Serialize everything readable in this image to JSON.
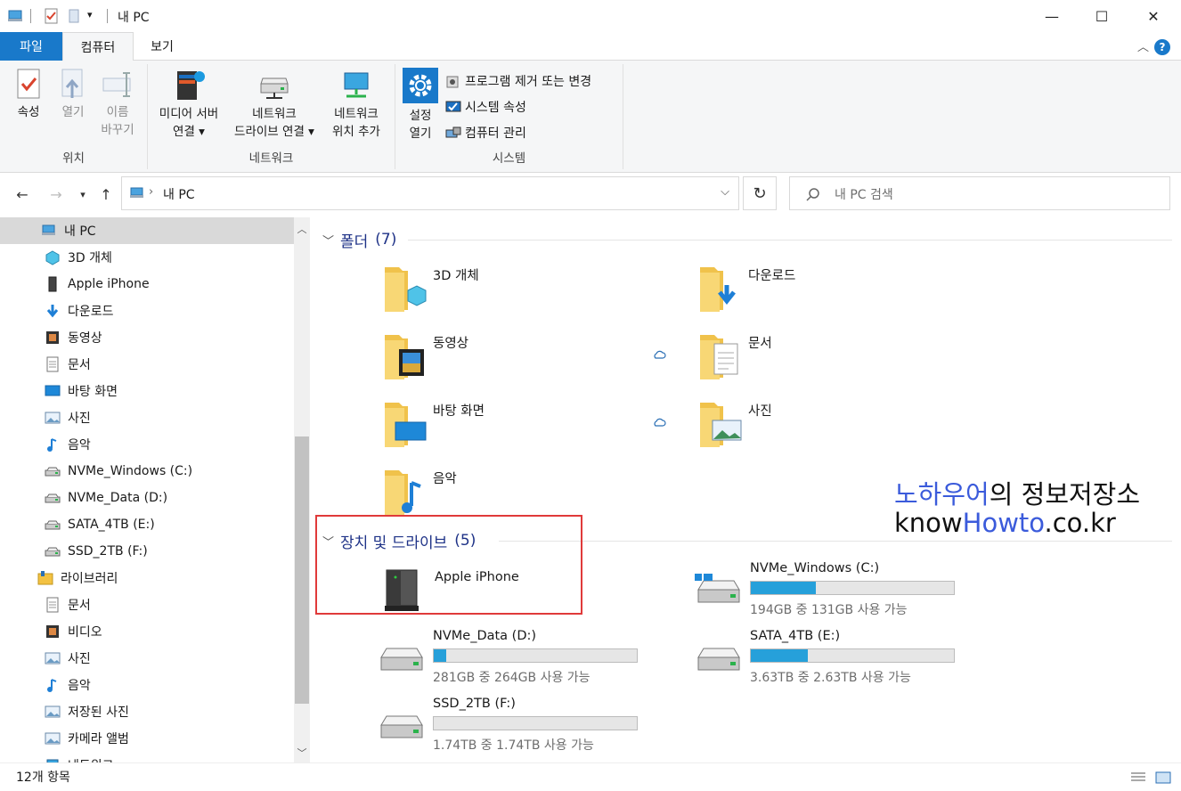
{
  "window": {
    "title": "내 PC",
    "minimize": "—",
    "maximize": "☐",
    "close": "✕"
  },
  "ribbon_tabs": {
    "file": "파일",
    "computer": "컴퓨터",
    "view": "보기",
    "help": "?"
  },
  "ribbon": {
    "location": {
      "label": "위치",
      "properties": "속성",
      "open": "열기",
      "rename_1": "이름",
      "rename_2": "바꾸기"
    },
    "network": {
      "label": "네트워크",
      "media_1": "미디어 서버",
      "media_2": "연결 ▾",
      "map_1": "네트워크",
      "map_2": "드라이브 연결 ▾",
      "add_1": "네트워크",
      "add_2": "위치 추가"
    },
    "system": {
      "label": "시스템",
      "settings_1": "설정",
      "settings_2": "열기",
      "uninstall": "프로그램 제거 또는 변경",
      "sysprops": "시스템 속성",
      "manage": "컴퓨터 관리"
    }
  },
  "address": {
    "path": "내 PC",
    "search_placeholder": "내 PC 검색"
  },
  "nav": {
    "items": [
      {
        "label": "내 PC",
        "icon": "pc-icon"
      },
      {
        "label": "3D 개체",
        "icon": "cube-icon"
      },
      {
        "label": "Apple iPhone",
        "icon": "phone-icon"
      },
      {
        "label": "다운로드",
        "icon": "download-icon"
      },
      {
        "label": "동영상",
        "icon": "video-icon"
      },
      {
        "label": "문서",
        "icon": "document-icon"
      },
      {
        "label": "바탕 화면",
        "icon": "desktop-icon"
      },
      {
        "label": "사진",
        "icon": "picture-icon"
      },
      {
        "label": "음악",
        "icon": "music-icon"
      },
      {
        "label": "NVMe_Windows (C:)",
        "icon": "drive-icon"
      },
      {
        "label": "NVMe_Data (D:)",
        "icon": "drive-icon"
      },
      {
        "label": "SATA_4TB (E:)",
        "icon": "drive-icon"
      },
      {
        "label": "SSD_2TB (F:)",
        "icon": "drive-icon"
      },
      {
        "label": "라이브러리",
        "icon": "library-icon"
      },
      {
        "label": "문서",
        "icon": "document-icon"
      },
      {
        "label": "비디오",
        "icon": "video-icon"
      },
      {
        "label": "사진",
        "icon": "picture-icon"
      },
      {
        "label": "음악",
        "icon": "music-icon"
      },
      {
        "label": "저장된 사진",
        "icon": "picture-icon"
      },
      {
        "label": "카메라 앨범",
        "icon": "picture-icon"
      },
      {
        "label": "네트워크",
        "icon": "network-icon"
      }
    ]
  },
  "folders_section": {
    "title": "폴더",
    "count": "(7)",
    "items": [
      {
        "name": "3D 개체",
        "icon": "cube-folder-icon"
      },
      {
        "name": "다운로드",
        "icon": "download-folder-icon"
      },
      {
        "name": "동영상",
        "icon": "video-folder-icon"
      },
      {
        "name": "문서",
        "icon": "document-folder-icon"
      },
      {
        "name": "바탕 화면",
        "icon": "desktop-folder-icon"
      },
      {
        "name": "사진",
        "icon": "picture-folder-icon"
      },
      {
        "name": "음악",
        "icon": "music-folder-icon"
      }
    ]
  },
  "drives_section": {
    "title": "장치 및 드라이브",
    "count": "(5)",
    "iphone": "Apple iPhone",
    "drives": [
      {
        "name": "NVMe_Windows (C:)",
        "free": "194GB 중 131GB 사용 가능",
        "used_fraction": 0.32
      },
      {
        "name": "NVMe_Data (D:)",
        "free": "281GB 중 264GB 사용 가능",
        "used_fraction": 0.06
      },
      {
        "name": "SATA_4TB (E:)",
        "free": "3.63TB 중 2.63TB 사용 가능",
        "used_fraction": 0.28
      },
      {
        "name": "SSD_2TB (F:)",
        "free": "1.74TB 중 1.74TB 사용 가능",
        "used_fraction": 0.0
      }
    ]
  },
  "watermark": {
    "line1_blue": "노하우어",
    "line1_black": "의 정보저장소",
    "line2_black1": "know",
    "line2_blue": "Howto",
    "line2_black2": ".co.kr"
  },
  "status": {
    "items": "12개 항목"
  },
  "colors": {
    "accent": "#1979ca",
    "drive_fill": "#26a0da",
    "highlight_box": "#e03a3a"
  }
}
